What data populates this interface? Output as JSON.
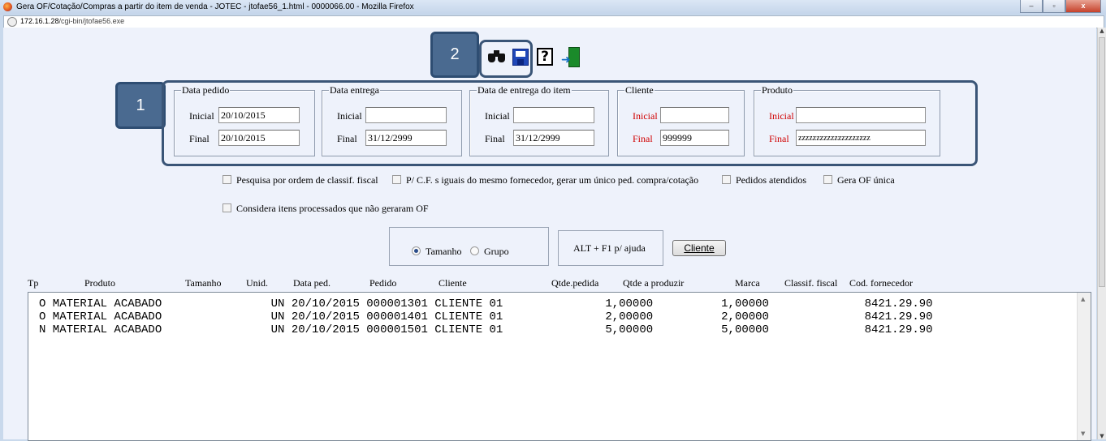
{
  "window": {
    "title": "Gera OF/Cotação/Compras a partir do item de venda - JOTEC - jtofae56_1.html - 0000066.00 - Mozilla Firefox",
    "url_host": "172.16.1.28",
    "url_path": "/cgi-bin/jtofae56.exe",
    "controls": {
      "minimize": "–",
      "maximize": "▫",
      "close": "x"
    }
  },
  "toolbar": {
    "icons": [
      "binoculars-icon",
      "save-icon",
      "help-icon",
      "exit-icon"
    ],
    "help_glyph": "?",
    "exit_glyph": "➜"
  },
  "callouts": {
    "one": "1",
    "two": "2"
  },
  "filters": {
    "data_pedido": {
      "legend": "Data pedido",
      "inicial_label": "Inicial",
      "final_label": "Final",
      "inicial_value": "20/10/2015",
      "final_value": "20/10/2015"
    },
    "data_entrega": {
      "legend": "Data entrega",
      "inicial_label": "Inicial",
      "final_label": "Final",
      "inicial_value": "",
      "final_value": "31/12/2999"
    },
    "data_entrega_item": {
      "legend": "Data de entrega do item",
      "inicial_label": "Inicial",
      "final_label": "Final",
      "inicial_value": "",
      "final_value": "31/12/2999"
    },
    "cliente": {
      "legend": "Cliente",
      "inicial_label": "Inicial",
      "final_label": "Final",
      "inicial_value": "",
      "final_value": "999999"
    },
    "produto": {
      "legend": "Produto",
      "inicial_label": "Inicial",
      "final_label": "Final",
      "inicial_value": "",
      "final_value": "zzzzzzzzzzzzzzzzzzzz"
    }
  },
  "options": {
    "pesquisa_classif": "Pesquisa por ordem de classif. fiscal",
    "cf_iguais": "P/ C.F. s iguais do mesmo fornecedor, gerar um único ped. compra/cotação",
    "pedidos_atendidos": "Pedidos atendidos",
    "gera_of_unica": "Gera OF única",
    "considera_itens": "Considera itens processados que não geraram OF"
  },
  "radio": {
    "tamanho": "Tamanho",
    "grupo": "Grupo",
    "selected": "Tamanho"
  },
  "help_hint": "ALT + F1 p/ ajuda",
  "cliente_button": "Cliente",
  "columns": [
    "Tp",
    "Produto",
    "Tamanho",
    "Unid.",
    "Data ped.",
    "Pedido",
    "Cliente",
    "Qtde.pedida",
    "Qtde a produzir",
    "Marca",
    "Classif. fiscal",
    "Cod. fornecedor"
  ],
  "rows": [
    "O MATERIAL ACABADO                UN 20/10/2015 000001301 CLIENTE 01               1,00000          1,00000              8421.29.90",
    "O MATERIAL ACABADO                UN 20/10/2015 000001401 CLIENTE 01               2,00000          2,00000              8421.29.90",
    "N MATERIAL ACABADO                UN 20/10/2015 000001501 CLIENTE 01               5,00000          5,00000              8421.29.90"
  ]
}
